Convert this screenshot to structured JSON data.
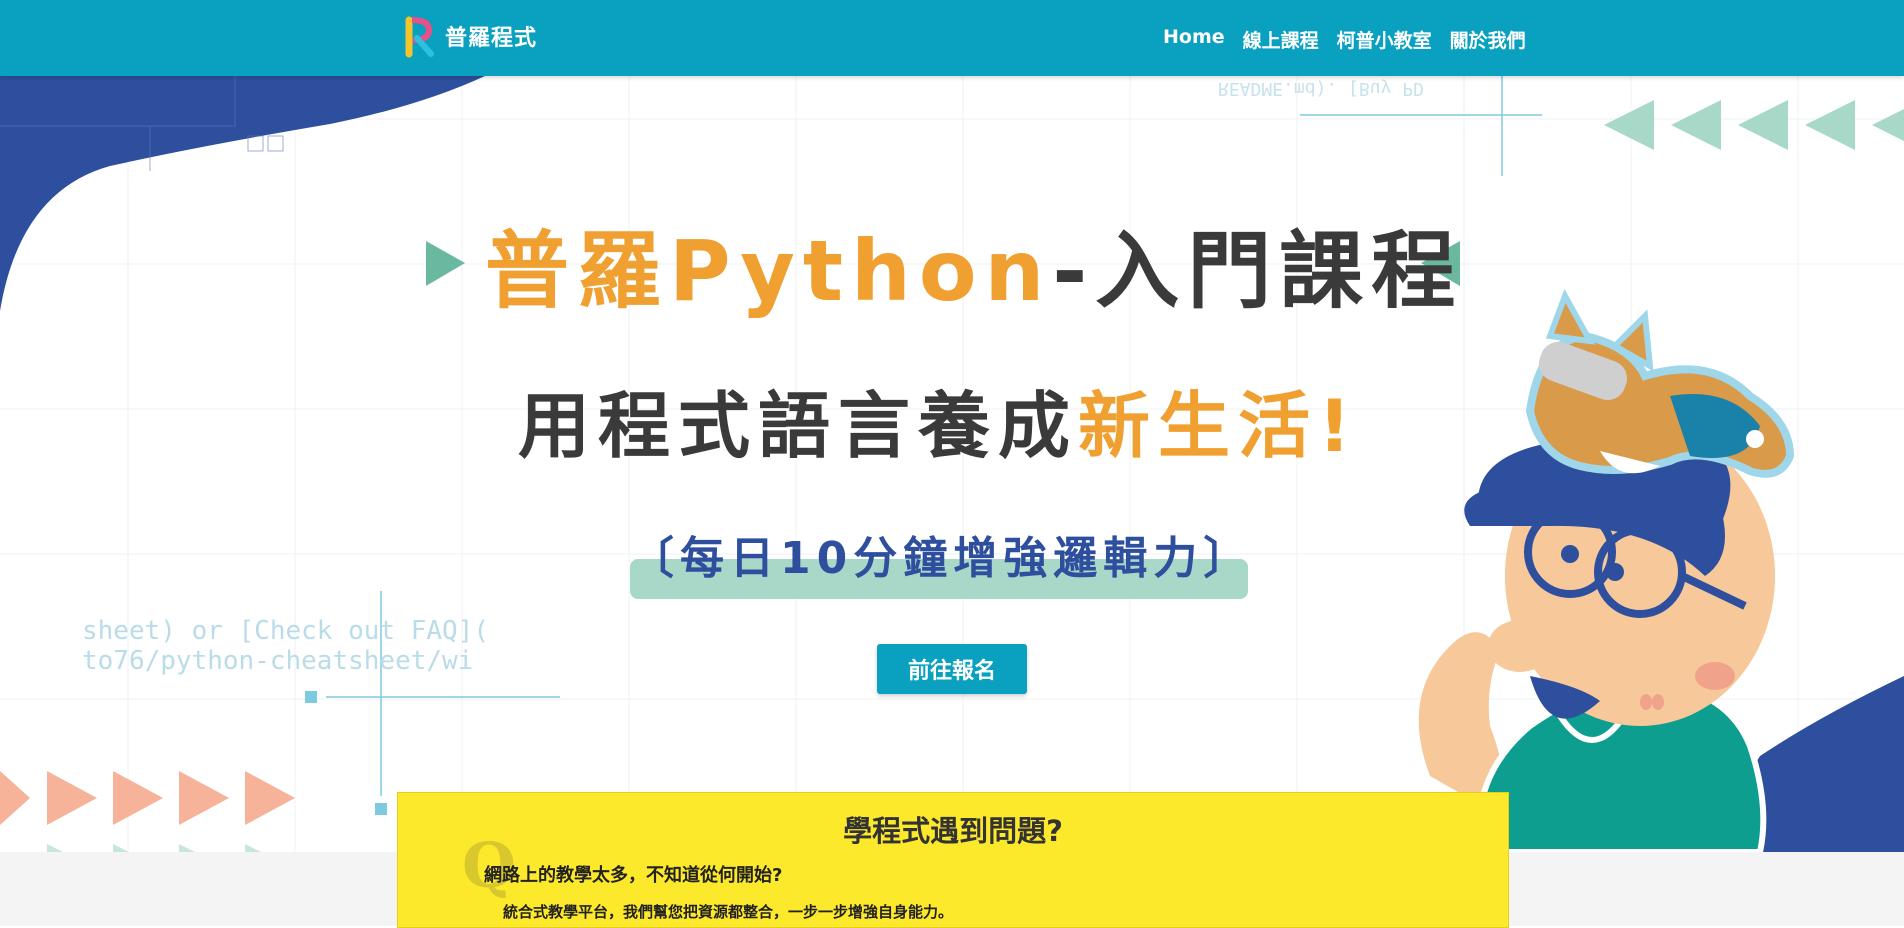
{
  "header": {
    "brand_name": "普羅程式",
    "nav": [
      "Home",
      "線上課程",
      "柯普小教室",
      "關於我們"
    ]
  },
  "hero": {
    "title_highlight": "普羅Python",
    "title_rest": "-入門課程",
    "subtitle_main": "用程式語言養成",
    "subtitle_highlight": "新生活!",
    "tagline": "〔每日10分鐘增強邏輯力〕",
    "cta_label": "前往報名",
    "code_fragments": {
      "top": "README.md). [Buy PD",
      "left_line1": "sheet) or [Check out FAQ](",
      "left_line2": "to76/python-cheatsheet/wi"
    }
  },
  "problem": {
    "q_mark": "Q",
    "title": "學程式遇到問題?",
    "question": "網路上的教學太多，不知道從何開始?",
    "answer": "統合式教學平台，我們幫您把資源都整合，一步一步增強自身能力。"
  },
  "colors": {
    "header": "#0aa0bf",
    "accent_orange": "#f0a030",
    "dark_text": "#3a3a3a",
    "navy": "#2e4f9e",
    "mint": "#a8d8c8",
    "salmon": "#f6b39a",
    "teal_triangle": "#6ab8a0",
    "card_yellow": "#fde92b"
  }
}
